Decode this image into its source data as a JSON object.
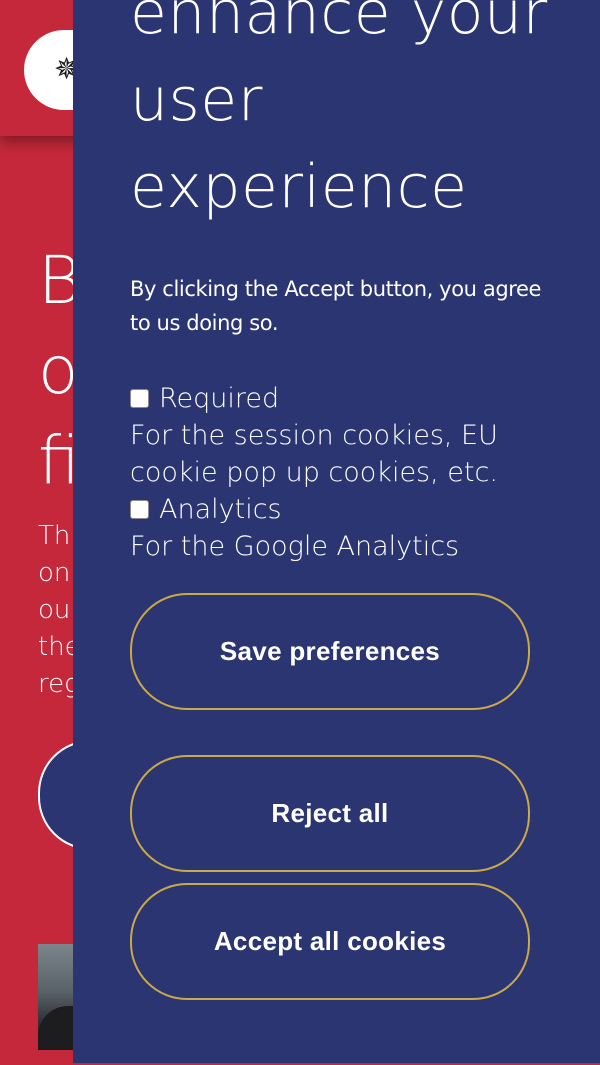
{
  "background_page": {
    "hero_lines": [
      "B",
      "o",
      "fi"
    ],
    "text_lines": [
      "Thi",
      "on",
      "ou",
      "the",
      "reg"
    ],
    "colors": {
      "header_bg": "#c4283a",
      "button_bg": "#2b3572"
    }
  },
  "cookie_panel": {
    "heading_lines": [
      "enhance your",
      "user",
      "experience"
    ],
    "intro": "By clicking the Accept button, you agree to us doing so.",
    "options": [
      {
        "label": "Required",
        "description": "For the session cookies, EU cookie pop up cookies, etc.",
        "checked": false
      },
      {
        "label": "Analytics",
        "description": "For the Google Analytics",
        "checked": false
      }
    ],
    "buttons": {
      "save": "Save preferences",
      "reject": "Reject all",
      "accept": "Accept all cookies"
    },
    "colors": {
      "panel_bg": "#2b3571",
      "button_border": "#c9a94a"
    }
  }
}
